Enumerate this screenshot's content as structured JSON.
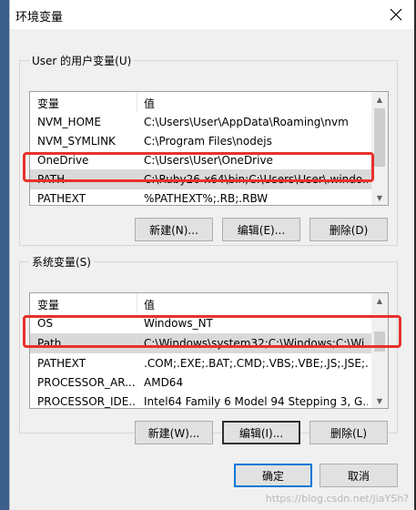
{
  "window": {
    "title": "环境变量"
  },
  "user_vars": {
    "legend": "User 的用户变量(U)",
    "columns": [
      "变量",
      "值"
    ],
    "rows": [
      {
        "name": "NVM_HOME",
        "value": "C:\\Users\\User\\AppData\\Roaming\\nvm"
      },
      {
        "name": "NVM_SYMLINK",
        "value": "C:\\Program Files\\nodejs"
      },
      {
        "name": "OneDrive",
        "value": "C:\\Users\\User\\OneDrive"
      },
      {
        "name": "PATH",
        "value": "C:\\Ruby26-x64\\bin;C:\\Users\\User\\.windo..."
      },
      {
        "name": "PATHEXT",
        "value": "%PATHEXT%;.RB;.RBW"
      }
    ],
    "selected_row": 3,
    "buttons": {
      "new": "新建(N)...",
      "edit": "编辑(E)...",
      "delete": "删除(D)"
    }
  },
  "system_vars": {
    "legend": "系统变量(S)",
    "columns": [
      "变量",
      "值"
    ],
    "rows": [
      {
        "name": "OS",
        "value": "Windows_NT"
      },
      {
        "name": "Path",
        "value": "C:\\Windows\\system32;C:\\Windows;C:\\Wi..."
      },
      {
        "name": "PATHEXT",
        "value": ".COM;.EXE;.BAT;.CMD;.VBS;.VBE;.JS;.JSE;..."
      },
      {
        "name": "PROCESSOR_AR...",
        "value": "AMD64"
      },
      {
        "name": "PROCESSOR_IDE...",
        "value": "Intel64 Family 6 Model 94 Stepping 3, G..."
      }
    ],
    "selected_row": 1,
    "buttons": {
      "new": "新建(W)...",
      "edit": "编辑(I)...",
      "delete": "删除(L)"
    }
  },
  "footer": {
    "ok": "确定",
    "cancel": "取消"
  },
  "watermark": "https://blog.csdn.net/JiaYSh?",
  "colors": {
    "highlight_box": "#e8312c",
    "selected_row": "#d9d9d9",
    "focus_blue": "#0078d7"
  }
}
